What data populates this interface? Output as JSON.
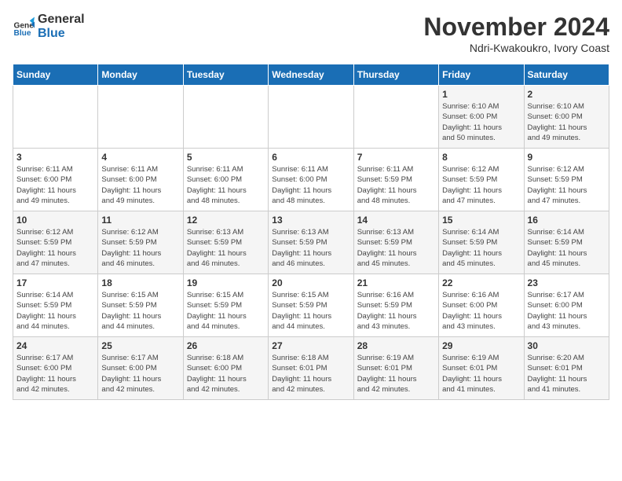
{
  "logo": {
    "general": "General",
    "blue": "Blue"
  },
  "title": "November 2024",
  "subtitle": "Ndri-Kwakoukro, Ivory Coast",
  "days_of_week": [
    "Sunday",
    "Monday",
    "Tuesday",
    "Wednesday",
    "Thursday",
    "Friday",
    "Saturday"
  ],
  "weeks": [
    [
      {
        "day": "",
        "info": ""
      },
      {
        "day": "",
        "info": ""
      },
      {
        "day": "",
        "info": ""
      },
      {
        "day": "",
        "info": ""
      },
      {
        "day": "",
        "info": ""
      },
      {
        "day": "1",
        "info": "Sunrise: 6:10 AM\nSunset: 6:00 PM\nDaylight: 11 hours\nand 50 minutes."
      },
      {
        "day": "2",
        "info": "Sunrise: 6:10 AM\nSunset: 6:00 PM\nDaylight: 11 hours\nand 49 minutes."
      }
    ],
    [
      {
        "day": "3",
        "info": "Sunrise: 6:11 AM\nSunset: 6:00 PM\nDaylight: 11 hours\nand 49 minutes."
      },
      {
        "day": "4",
        "info": "Sunrise: 6:11 AM\nSunset: 6:00 PM\nDaylight: 11 hours\nand 49 minutes."
      },
      {
        "day": "5",
        "info": "Sunrise: 6:11 AM\nSunset: 6:00 PM\nDaylight: 11 hours\nand 48 minutes."
      },
      {
        "day": "6",
        "info": "Sunrise: 6:11 AM\nSunset: 6:00 PM\nDaylight: 11 hours\nand 48 minutes."
      },
      {
        "day": "7",
        "info": "Sunrise: 6:11 AM\nSunset: 5:59 PM\nDaylight: 11 hours\nand 48 minutes."
      },
      {
        "day": "8",
        "info": "Sunrise: 6:12 AM\nSunset: 5:59 PM\nDaylight: 11 hours\nand 47 minutes."
      },
      {
        "day": "9",
        "info": "Sunrise: 6:12 AM\nSunset: 5:59 PM\nDaylight: 11 hours\nand 47 minutes."
      }
    ],
    [
      {
        "day": "10",
        "info": "Sunrise: 6:12 AM\nSunset: 5:59 PM\nDaylight: 11 hours\nand 47 minutes."
      },
      {
        "day": "11",
        "info": "Sunrise: 6:12 AM\nSunset: 5:59 PM\nDaylight: 11 hours\nand 46 minutes."
      },
      {
        "day": "12",
        "info": "Sunrise: 6:13 AM\nSunset: 5:59 PM\nDaylight: 11 hours\nand 46 minutes."
      },
      {
        "day": "13",
        "info": "Sunrise: 6:13 AM\nSunset: 5:59 PM\nDaylight: 11 hours\nand 46 minutes."
      },
      {
        "day": "14",
        "info": "Sunrise: 6:13 AM\nSunset: 5:59 PM\nDaylight: 11 hours\nand 45 minutes."
      },
      {
        "day": "15",
        "info": "Sunrise: 6:14 AM\nSunset: 5:59 PM\nDaylight: 11 hours\nand 45 minutes."
      },
      {
        "day": "16",
        "info": "Sunrise: 6:14 AM\nSunset: 5:59 PM\nDaylight: 11 hours\nand 45 minutes."
      }
    ],
    [
      {
        "day": "17",
        "info": "Sunrise: 6:14 AM\nSunset: 5:59 PM\nDaylight: 11 hours\nand 44 minutes."
      },
      {
        "day": "18",
        "info": "Sunrise: 6:15 AM\nSunset: 5:59 PM\nDaylight: 11 hours\nand 44 minutes."
      },
      {
        "day": "19",
        "info": "Sunrise: 6:15 AM\nSunset: 5:59 PM\nDaylight: 11 hours\nand 44 minutes."
      },
      {
        "day": "20",
        "info": "Sunrise: 6:15 AM\nSunset: 5:59 PM\nDaylight: 11 hours\nand 44 minutes."
      },
      {
        "day": "21",
        "info": "Sunrise: 6:16 AM\nSunset: 5:59 PM\nDaylight: 11 hours\nand 43 minutes."
      },
      {
        "day": "22",
        "info": "Sunrise: 6:16 AM\nSunset: 6:00 PM\nDaylight: 11 hours\nand 43 minutes."
      },
      {
        "day": "23",
        "info": "Sunrise: 6:17 AM\nSunset: 6:00 PM\nDaylight: 11 hours\nand 43 minutes."
      }
    ],
    [
      {
        "day": "24",
        "info": "Sunrise: 6:17 AM\nSunset: 6:00 PM\nDaylight: 11 hours\nand 42 minutes."
      },
      {
        "day": "25",
        "info": "Sunrise: 6:17 AM\nSunset: 6:00 PM\nDaylight: 11 hours\nand 42 minutes."
      },
      {
        "day": "26",
        "info": "Sunrise: 6:18 AM\nSunset: 6:00 PM\nDaylight: 11 hours\nand 42 minutes."
      },
      {
        "day": "27",
        "info": "Sunrise: 6:18 AM\nSunset: 6:01 PM\nDaylight: 11 hours\nand 42 minutes."
      },
      {
        "day": "28",
        "info": "Sunrise: 6:19 AM\nSunset: 6:01 PM\nDaylight: 11 hours\nand 42 minutes."
      },
      {
        "day": "29",
        "info": "Sunrise: 6:19 AM\nSunset: 6:01 PM\nDaylight: 11 hours\nand 41 minutes."
      },
      {
        "day": "30",
        "info": "Sunrise: 6:20 AM\nSunset: 6:01 PM\nDaylight: 11 hours\nand 41 minutes."
      }
    ]
  ]
}
